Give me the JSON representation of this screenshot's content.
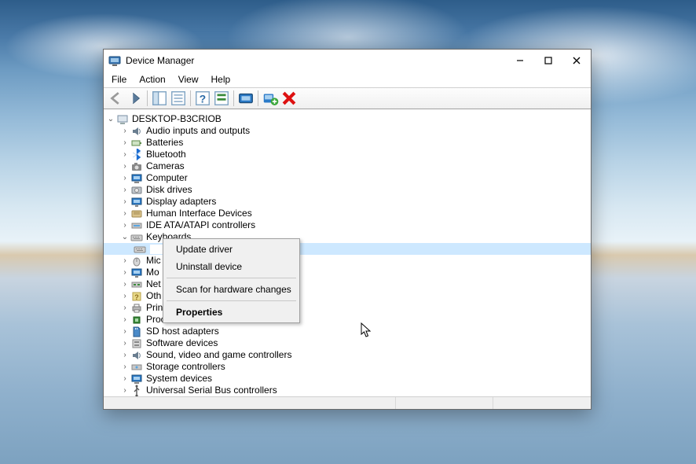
{
  "window": {
    "title": "Device Manager"
  },
  "menubar": [
    "File",
    "Action",
    "View",
    "Help"
  ],
  "tree": {
    "root": "DESKTOP-B3CRIOB",
    "items": [
      "Audio inputs and outputs",
      "Batteries",
      "Bluetooth",
      "Cameras",
      "Computer",
      "Disk drives",
      "Display adapters",
      "Human Interface Devices",
      "IDE ATA/ATAPI controllers",
      "Keyboards",
      "Mic",
      "Mo",
      "Net",
      "Oth",
      "Prin",
      "Processors",
      "SD host adapters",
      "Software devices",
      "Sound, video and game controllers",
      "Storage controllers",
      "System devices",
      "Universal Serial Bus controllers"
    ]
  },
  "context_menu": {
    "items": [
      "Update driver",
      "Uninstall device",
      "Scan for hardware changes",
      "Properties"
    ]
  }
}
